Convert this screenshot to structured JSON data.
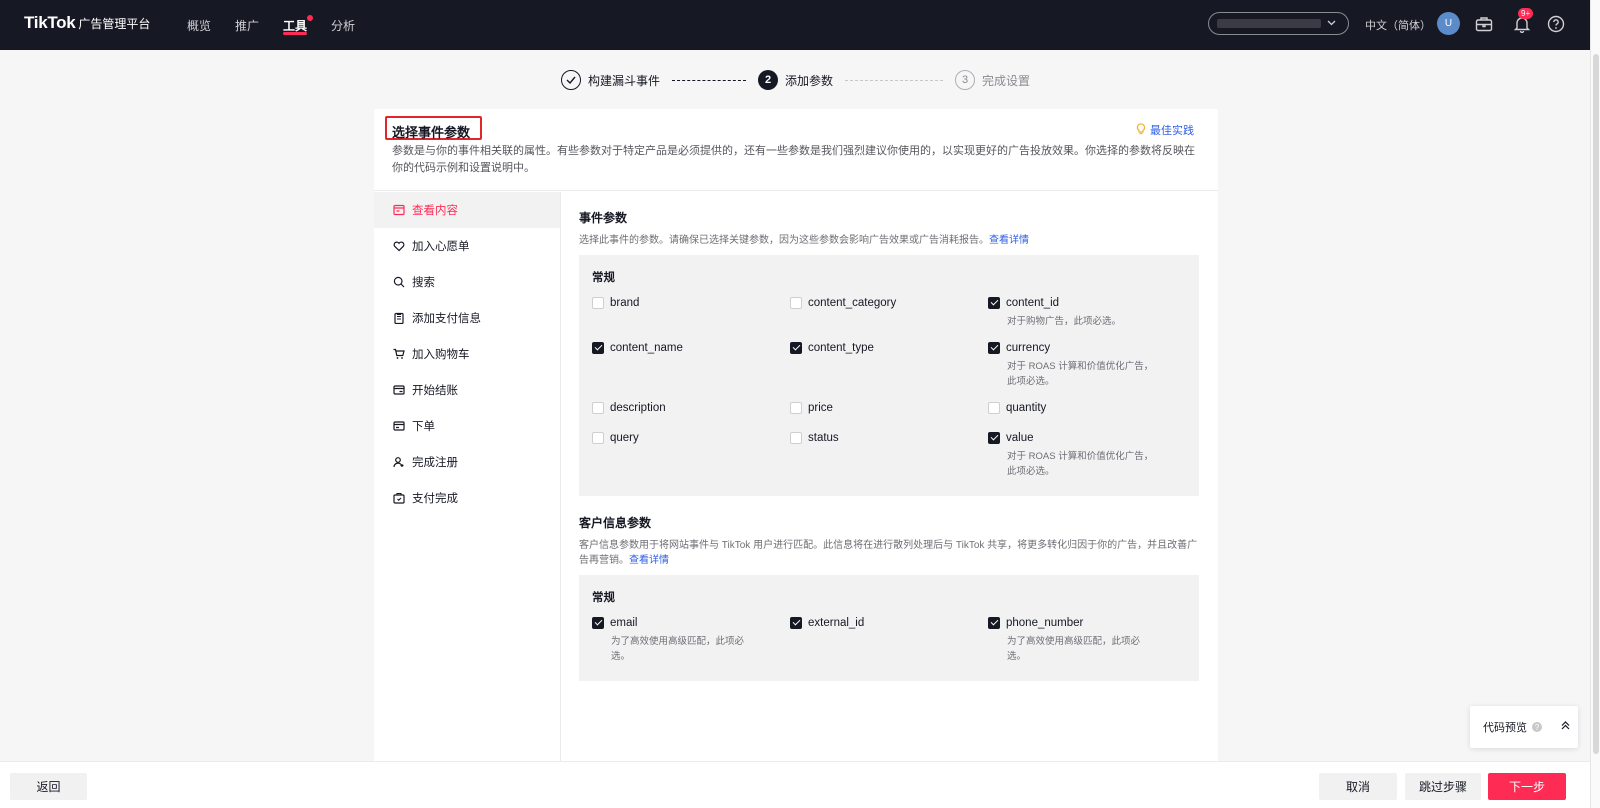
{
  "header": {
    "logo": "TikTok",
    "logo_sub": "广告管理平台",
    "nav": [
      "概览",
      "推广",
      "工具",
      "分析"
    ],
    "active_nav": "工具",
    "lang": "中文（简体）",
    "avatar_initial": "U",
    "notif_badge": "9+"
  },
  "stepper": {
    "steps": [
      {
        "label": "构建漏斗事件",
        "state": "done"
      },
      {
        "num": "2",
        "label": "添加参数",
        "state": "current"
      },
      {
        "num": "3",
        "label": "完成设置",
        "state": "pending"
      }
    ]
  },
  "card": {
    "title": "选择事件参数",
    "best_practice": "最佳实践",
    "description": "参数是与你的事件相关联的属性。有些参数对于特定产品是必须提供的，还有一些参数是我们强烈建议你使用的，以实现更好的广告投放效果。你选择的参数将反映在你的代码示例和设置说明中。"
  },
  "events": [
    {
      "label": "查看内容",
      "icon": "view-content-icon",
      "active": true
    },
    {
      "label": "加入心愿单",
      "icon": "wishlist-icon"
    },
    {
      "label": "搜索",
      "icon": "search-icon"
    },
    {
      "label": "添加支付信息",
      "icon": "payment-info-icon"
    },
    {
      "label": "加入购物车",
      "icon": "cart-icon"
    },
    {
      "label": "开始结账",
      "icon": "checkout-icon"
    },
    {
      "label": "下单",
      "icon": "order-icon"
    },
    {
      "label": "完成注册",
      "icon": "register-icon"
    },
    {
      "label": "支付完成",
      "icon": "payment-done-icon"
    }
  ],
  "event_params": {
    "title": "事件参数",
    "desc": "选择此事件的参数。请确保已选择关键参数，因为这些参数会影响广告效果或广告消耗报告。",
    "link": "查看详情",
    "group": "常规",
    "params": [
      {
        "name": "brand",
        "checked": false
      },
      {
        "name": "content_category",
        "checked": false
      },
      {
        "name": "content_id",
        "checked": true,
        "hint": "对于购物广告，此项必选。"
      },
      {
        "name": "content_name",
        "checked": true
      },
      {
        "name": "content_type",
        "checked": true
      },
      {
        "name": "currency",
        "checked": true,
        "hint": "对于 ROAS 计算和价值优化广告，此项必选。"
      },
      {
        "name": "description",
        "checked": false
      },
      {
        "name": "price",
        "checked": false
      },
      {
        "name": "quantity",
        "checked": false
      },
      {
        "name": "query",
        "checked": false
      },
      {
        "name": "status",
        "checked": false
      },
      {
        "name": "value",
        "checked": true,
        "hint": "对于 ROAS 计算和价值优化广告，此项必选。"
      }
    ]
  },
  "customer_params": {
    "title": "客户信息参数",
    "desc": "客户信息参数用于将网站事件与 TikTok 用户进行匹配。此信息将在进行散列处理后与 TikTok 共享，将更多转化归因于你的广告，并且改善广告再营销。",
    "link": "查看详情",
    "group": "常规",
    "params": [
      {
        "name": "email",
        "checked": true,
        "hint": "为了高效使用高级匹配，此项必选。"
      },
      {
        "name": "external_id",
        "checked": true
      },
      {
        "name": "phone_number",
        "checked": true,
        "hint": "为了高效使用高级匹配，此项必选。"
      }
    ]
  },
  "code_preview": {
    "label": "代码预览"
  },
  "footer": {
    "back": "返回",
    "cancel": "取消",
    "skip": "跳过步骤",
    "next": "下一步"
  },
  "colors": {
    "accent": "#fe2c55",
    "dark": "#161823",
    "link": "#2d5ee7"
  }
}
